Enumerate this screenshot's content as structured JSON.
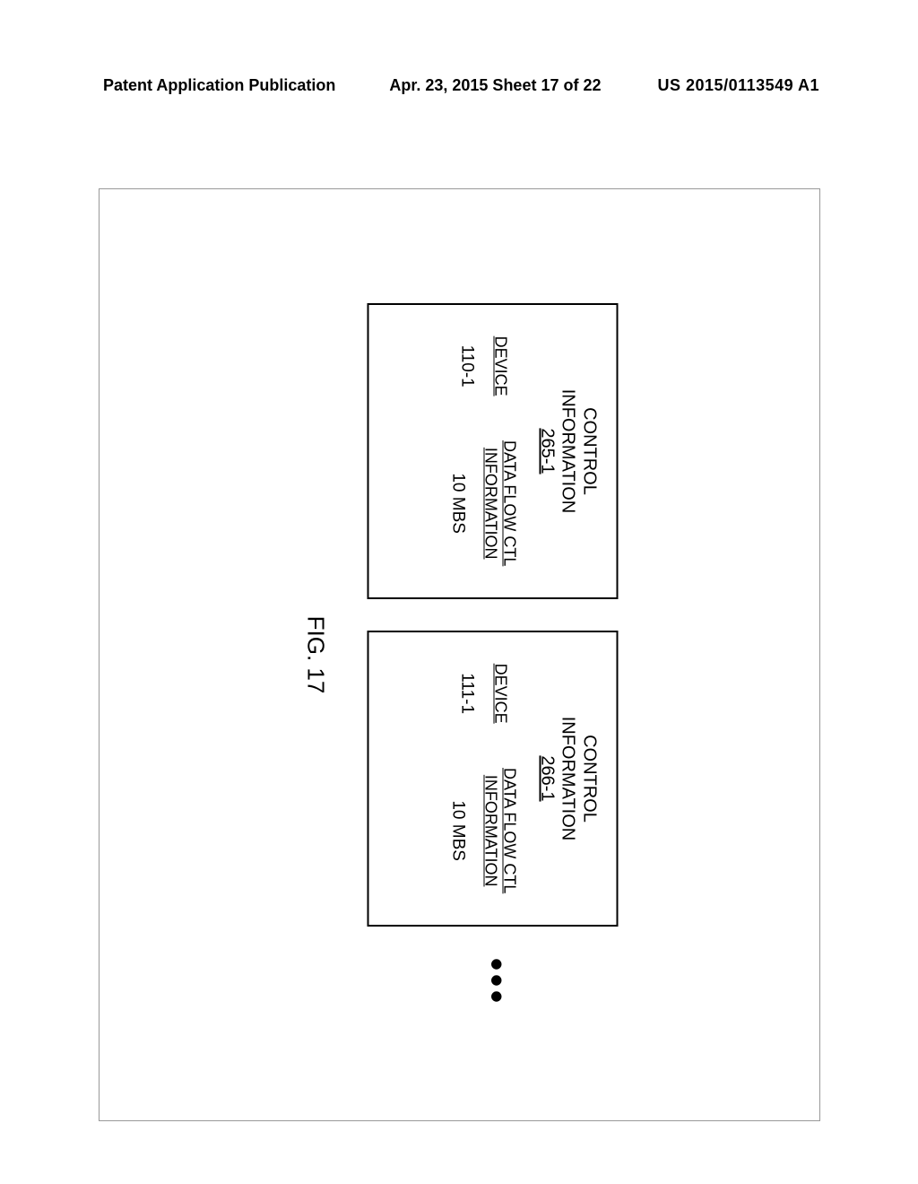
{
  "header": {
    "left1": "Patent Application Publication",
    "left2": "Apr. 23, 2015  Sheet 17 of 22",
    "right": "US 2015/0113549 A1"
  },
  "boxes": [
    {
      "title_line1": "CONTROL",
      "title_line2": "INFORMATION",
      "ref": "265-1",
      "col1_header": "DEVICE",
      "col1_value": "110-1",
      "col2_header_line1": "DATA FLOW CTL",
      "col2_header_line2": "INFORMATION",
      "col2_value": "10 MBS"
    },
    {
      "title_line1": "CONTROL",
      "title_line2": "INFORMATION",
      "ref": "266-1",
      "col1_header": "DEVICE",
      "col1_value": "111-1",
      "col2_header_line1": "DATA FLOW CTL",
      "col2_header_line2": "INFORMATION",
      "col2_value": "10 MBS"
    }
  ],
  "ellipsis": "•••",
  "figure_label": "FIG. 17"
}
